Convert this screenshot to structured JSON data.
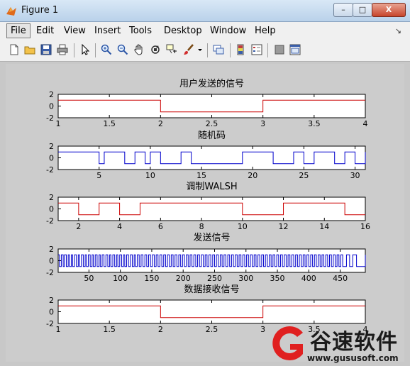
{
  "window": {
    "title": "Figure 1",
    "min_label": "–",
    "max_label": "□",
    "close_label": "X"
  },
  "menu": [
    {
      "key": "file",
      "label": "File"
    },
    {
      "key": "edit",
      "label": "Edit"
    },
    {
      "key": "view",
      "label": "View"
    },
    {
      "key": "insert",
      "label": "Insert"
    },
    {
      "key": "tools",
      "label": "Tools"
    },
    {
      "key": "desktop",
      "label": "Desktop"
    },
    {
      "key": "window",
      "label": "Window"
    },
    {
      "key": "help",
      "label": "Help"
    }
  ],
  "menu_grip": "↘",
  "toolbar": [
    "new-figure-icon",
    "open-icon",
    "save-icon",
    "print-icon",
    "pointer-icon",
    "zoom-in-icon",
    "zoom-out-icon",
    "pan-icon",
    "rotate-icon",
    "data-cursor-icon",
    "brush-icon",
    "link-icon",
    "colorbar-icon",
    "legend-icon",
    "hide-tools-icon",
    "show-tools-icon"
  ],
  "colors": {
    "red": "#cc0000",
    "blue": "#0000cc"
  },
  "chart_data": [
    {
      "type": "line",
      "title": "用户发送的信号",
      "color": "red",
      "xlim": [
        1,
        4
      ],
      "ylim": [
        -2,
        2
      ],
      "xticks": [
        1,
        1.5,
        2,
        2.5,
        3,
        3.5,
        4
      ],
      "xticklabels": [
        "1",
        "1.5",
        "2",
        "2.5",
        "3",
        "3.5",
        "4"
      ],
      "yticks": [
        2,
        0,
        -2
      ],
      "yticklabels": [
        "2",
        "0",
        "-2"
      ],
      "steps": [
        [
          1,
          1
        ],
        [
          2,
          -1
        ],
        [
          3,
          1
        ],
        [
          4,
          1
        ]
      ]
    },
    {
      "type": "line",
      "title": "随机码",
      "color": "blue",
      "xlim": [
        1,
        31
      ],
      "ylim": [
        -2,
        2
      ],
      "xticks": [
        5,
        10,
        15,
        20,
        25,
        30
      ],
      "xticklabels": [
        "5",
        "10",
        "15",
        "20",
        "25",
        "30"
      ],
      "yticks": [
        2,
        0,
        -2
      ],
      "yticklabels": [
        "2",
        "0",
        "-2"
      ],
      "steps": [
        [
          1,
          1
        ],
        [
          5,
          -1
        ],
        [
          5.5,
          1
        ],
        [
          7.5,
          -1
        ],
        [
          8.5,
          1
        ],
        [
          9.5,
          -1
        ],
        [
          10,
          1
        ],
        [
          11,
          -1
        ],
        [
          13,
          1
        ],
        [
          14,
          -1
        ],
        [
          19,
          1
        ],
        [
          22,
          -1
        ],
        [
          24,
          1
        ],
        [
          25,
          -1
        ],
        [
          26,
          1
        ],
        [
          28,
          -1
        ],
        [
          29,
          1
        ],
        [
          30,
          -1
        ],
        [
          31,
          1
        ]
      ]
    },
    {
      "type": "line",
      "title": "调制WALSH",
      "color": "red",
      "xlim": [
        1,
        16
      ],
      "ylim": [
        -2,
        2
      ],
      "xticks": [
        2,
        4,
        6,
        8,
        10,
        12,
        14,
        16
      ],
      "xticklabels": [
        "2",
        "4",
        "6",
        "8",
        "10",
        "12",
        "14",
        "16"
      ],
      "yticks": [
        2,
        0,
        -2
      ],
      "yticklabels": [
        "2",
        "0",
        "-2"
      ],
      "steps": [
        [
          1,
          1
        ],
        [
          2,
          -1
        ],
        [
          3,
          1
        ],
        [
          4,
          -1
        ],
        [
          5,
          1
        ],
        [
          10,
          -1
        ],
        [
          12,
          1
        ],
        [
          15,
          -1
        ],
        [
          16,
          -1
        ]
      ]
    },
    {
      "type": "line",
      "title": "发送信号",
      "color": "blue",
      "xlim": [
        1,
        490
      ],
      "ylim": [
        -2,
        2
      ],
      "xticks": [
        50,
        100,
        150,
        200,
        250,
        300,
        350,
        400,
        450
      ],
      "xticklabels": [
        "50",
        "100",
        "150",
        "200",
        "250",
        "300",
        "350",
        "400",
        "450"
      ],
      "yticks": [
        2,
        0,
        -2
      ],
      "yticklabels": [
        "2",
        "0",
        "-2"
      ],
      "steps": [
        [
          1,
          1
        ],
        [
          3,
          -1
        ],
        [
          6,
          1
        ],
        [
          9,
          -1
        ],
        [
          11,
          1
        ],
        [
          14,
          -1
        ],
        [
          17,
          1
        ],
        [
          19,
          -1
        ],
        [
          22,
          1
        ],
        [
          24,
          -1
        ],
        [
          27,
          1
        ],
        [
          30,
          -1
        ],
        [
          33,
          1
        ],
        [
          35,
          -1
        ],
        [
          38,
          1
        ],
        [
          41,
          -1
        ],
        [
          44,
          1
        ],
        [
          46,
          -1
        ],
        [
          49,
          1
        ],
        [
          52,
          -1
        ],
        [
          55,
          1
        ],
        [
          57,
          -1
        ],
        [
          60,
          1
        ],
        [
          63,
          -1
        ],
        [
          66,
          1
        ],
        [
          68,
          -1
        ],
        [
          71,
          1
        ],
        [
          74,
          -1
        ],
        [
          77,
          1
        ],
        [
          80,
          -1
        ],
        [
          83,
          1
        ],
        [
          85,
          -1
        ],
        [
          88,
          1
        ],
        [
          91,
          -1
        ],
        [
          94,
          1
        ],
        [
          96,
          -1
        ],
        [
          99,
          1
        ],
        [
          102,
          -1
        ],
        [
          105,
          1
        ],
        [
          107,
          -1
        ],
        [
          110,
          1
        ],
        [
          113,
          -1
        ],
        [
          116,
          1
        ],
        [
          119,
          -1
        ],
        [
          122,
          1
        ],
        [
          124,
          -1
        ],
        [
          127,
          1
        ],
        [
          130,
          -1
        ],
        [
          133,
          1
        ],
        [
          136,
          -1
        ],
        [
          139,
          1
        ],
        [
          142,
          -1
        ],
        [
          145,
          1
        ],
        [
          148,
          -1
        ],
        [
          151,
          1
        ],
        [
          154,
          -1
        ],
        [
          157,
          1
        ],
        [
          160,
          -1
        ],
        [
          163,
          1
        ],
        [
          166,
          -1
        ],
        [
          169,
          1
        ],
        [
          172,
          -1
        ],
        [
          175,
          1
        ],
        [
          178,
          -1
        ],
        [
          181,
          1
        ],
        [
          184,
          -1
        ],
        [
          187,
          1
        ],
        [
          190,
          -1
        ],
        [
          193,
          1
        ],
        [
          196,
          -1
        ],
        [
          199,
          1
        ],
        [
          202,
          -1
        ],
        [
          205,
          1
        ],
        [
          208,
          -1
        ],
        [
          211,
          1
        ],
        [
          214,
          -1
        ],
        [
          217,
          1
        ],
        [
          220,
          -1
        ],
        [
          223,
          1
        ],
        [
          226,
          -1
        ],
        [
          229,
          1
        ],
        [
          232,
          -1
        ],
        [
          235,
          1
        ],
        [
          238,
          -1
        ],
        [
          241,
          1
        ],
        [
          244,
          -1
        ],
        [
          247,
          1
        ],
        [
          250,
          -1
        ],
        [
          253,
          1
        ],
        [
          256,
          -1
        ],
        [
          259,
          1
        ],
        [
          262,
          -1
        ],
        [
          265,
          1
        ],
        [
          268,
          -1
        ],
        [
          271,
          1
        ],
        [
          274,
          -1
        ],
        [
          277,
          1
        ],
        [
          280,
          -1
        ],
        [
          283,
          1
        ],
        [
          286,
          -1
        ],
        [
          289,
          1
        ],
        [
          292,
          -1
        ],
        [
          295,
          1
        ],
        [
          298,
          -1
        ],
        [
          301,
          1
        ],
        [
          304,
          -1
        ],
        [
          307,
          1
        ],
        [
          310,
          -1
        ],
        [
          313,
          1
        ],
        [
          316,
          -1
        ],
        [
          319,
          1
        ],
        [
          322,
          -1
        ],
        [
          325,
          1
        ],
        [
          328,
          -1
        ],
        [
          331,
          1
        ],
        [
          334,
          -1
        ],
        [
          337,
          1
        ],
        [
          340,
          -1
        ],
        [
          343,
          1
        ],
        [
          346,
          -1
        ],
        [
          349,
          1
        ],
        [
          352,
          -1
        ],
        [
          355,
          1
        ],
        [
          358,
          -1
        ],
        [
          361,
          1
        ],
        [
          364,
          -1
        ],
        [
          367,
          1
        ],
        [
          370,
          -1
        ],
        [
          373,
          1
        ],
        [
          376,
          -1
        ],
        [
          379,
          1
        ],
        [
          382,
          -1
        ],
        [
          385,
          1
        ],
        [
          388,
          -1
        ],
        [
          391,
          1
        ],
        [
          394,
          -1
        ],
        [
          397,
          1
        ],
        [
          400,
          -1
        ],
        [
          403,
          1
        ],
        [
          406,
          -1
        ],
        [
          409,
          1
        ],
        [
          412,
          -1
        ],
        [
          415,
          1
        ],
        [
          418,
          -1
        ],
        [
          421,
          1
        ],
        [
          424,
          -1
        ],
        [
          427,
          1
        ],
        [
          430,
          -1
        ],
        [
          433,
          1
        ],
        [
          436,
          -1
        ],
        [
          439,
          1
        ],
        [
          442,
          -1
        ],
        [
          445,
          1
        ],
        [
          448,
          -1
        ],
        [
          451,
          1
        ],
        [
          454,
          -1
        ],
        [
          460,
          1
        ],
        [
          465,
          -1
        ],
        [
          470,
          1
        ],
        [
          476,
          -1
        ],
        [
          490,
          1
        ]
      ]
    },
    {
      "type": "line",
      "title": "数据接收信号",
      "color": "red",
      "xlim": [
        1,
        4
      ],
      "ylim": [
        -2,
        2
      ],
      "xticks": [
        1,
        1.5,
        2,
        2.5,
        3,
        3.5,
        4
      ],
      "xticklabels": [
        "1",
        "1.5",
        "2",
        "2.5",
        "3",
        "3.5",
        "4"
      ],
      "yticks": [
        2,
        0,
        -2
      ],
      "yticklabels": [
        "2",
        "0",
        "-2"
      ],
      "steps": [
        [
          1,
          1
        ],
        [
          2,
          -1
        ],
        [
          3,
          1
        ],
        [
          4,
          1
        ]
      ]
    }
  ],
  "watermark": {
    "brand": "谷速软件",
    "url": "www.gususoft.com"
  }
}
